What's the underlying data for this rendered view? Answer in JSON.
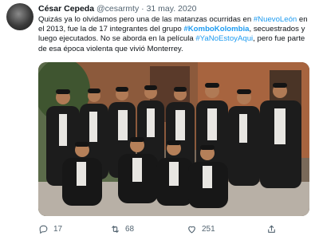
{
  "tweet": {
    "author_name": "César Cepeda",
    "handle": "@cesarmty",
    "separator": "·",
    "date": "31 may. 2020",
    "text_parts": [
      {
        "text": "Quizás ya lo olvidamos pero una de las matanzas ocurridas en ",
        "style": "plain"
      },
      {
        "text": "#NuevoLeón",
        "style": "link"
      },
      {
        "text": " en el 2013, fue la de 17 integrantes del grupo ",
        "style": "plain"
      },
      {
        "text": "#KomboKolombia",
        "style": "link-bold"
      },
      {
        "text": ", secuestrados y luego ejecutados. No se aborda en la película ",
        "style": "plain"
      },
      {
        "text": "#YaNoEstoyAqui",
        "style": "link"
      },
      {
        "text": ", pero fue parte de esa época violenta que vivió Monterrey.",
        "style": "plain"
      }
    ],
    "actions": {
      "replies": "17",
      "retweets": "68",
      "likes": "251"
    },
    "icons": {
      "reply": "reply-icon",
      "retweet": "retweet-icon",
      "like": "heart-icon",
      "share": "share-icon"
    },
    "colors": {
      "link": "#1d9bf0",
      "text": "#0f1419",
      "muted": "#536471"
    }
  }
}
